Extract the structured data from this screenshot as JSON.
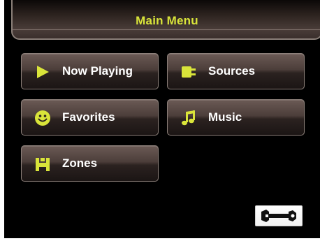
{
  "header": {
    "title": "Main Menu"
  },
  "menu": {
    "items": [
      {
        "label": "Now Playing",
        "icon": "play-icon"
      },
      {
        "label": "Sources",
        "icon": "plug-icon"
      },
      {
        "label": "Favorites",
        "icon": "smiley-icon"
      },
      {
        "label": "Music",
        "icon": "music-note-icon"
      },
      {
        "label": "Zones",
        "icon": "zones-icon"
      }
    ]
  },
  "settings": {
    "icon": "wrench-icon"
  },
  "colors": {
    "accent": "#d9e43a",
    "background": "#000000",
    "button_text": "#ffffff"
  }
}
